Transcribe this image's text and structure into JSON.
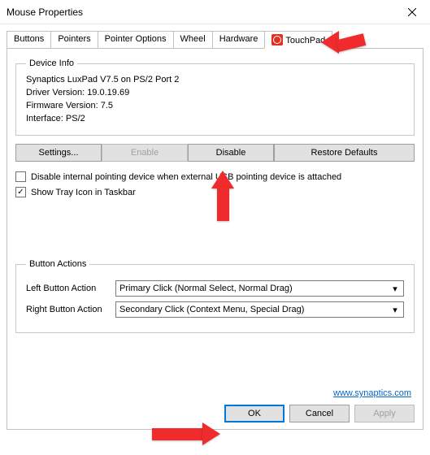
{
  "window": {
    "title": "Mouse Properties"
  },
  "tabs": {
    "items": [
      {
        "label": "Buttons"
      },
      {
        "label": "Pointers"
      },
      {
        "label": "Pointer Options"
      },
      {
        "label": "Wheel"
      },
      {
        "label": "Hardware"
      },
      {
        "label": "TouchPad"
      }
    ]
  },
  "device_info": {
    "legend": "Device Info",
    "lines": {
      "name": "Synaptics LuxPad V7.5 on PS/2 Port 2",
      "driver": "Driver Version: 19.0.19.69",
      "firmware": "Firmware Version: 7.5",
      "interface": "Interface: PS/2"
    }
  },
  "buttons": {
    "settings": "Settings...",
    "enable": "Enable",
    "disable": "Disable",
    "restore": "Restore Defaults"
  },
  "checkboxes": {
    "disable_internal": "Disable internal pointing device when external USB pointing device is attached",
    "show_tray": "Show Tray Icon in Taskbar"
  },
  "button_actions": {
    "legend": "Button Actions",
    "left_label": "Left Button Action",
    "left_value": "Primary Click (Normal Select, Normal Drag)",
    "right_label": "Right Button Action",
    "right_value": "Secondary Click (Context Menu, Special Drag)"
  },
  "link": {
    "text": "www.synaptics.com"
  },
  "dialog_buttons": {
    "ok": "OK",
    "cancel": "Cancel",
    "apply": "Apply"
  }
}
